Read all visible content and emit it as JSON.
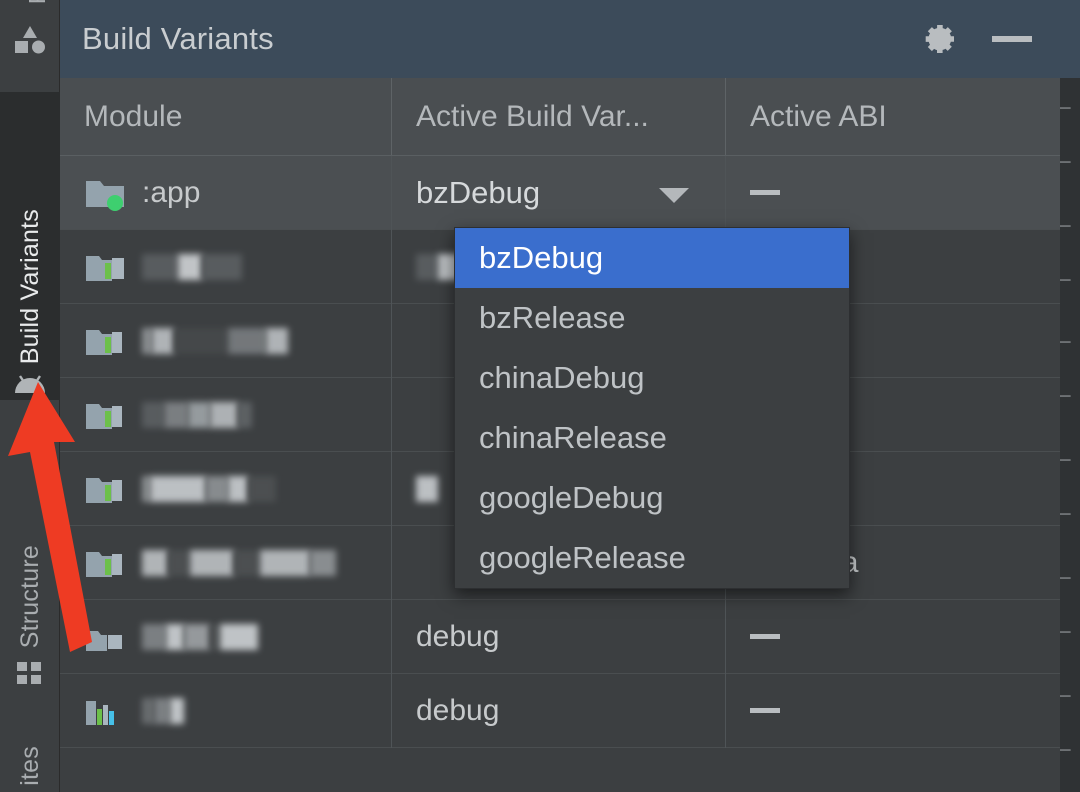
{
  "window": {
    "panel_title": "Build Variants",
    "settings_icon": "gear-icon",
    "minimize_icon": "minimize-icon"
  },
  "sidebar": {
    "clipped_top_label": "F",
    "top_icon": "resource-manager-shapes-icon",
    "items": [
      {
        "label": "Build Variants",
        "icon": "android-robot-icon",
        "active": true
      },
      {
        "label": "Structure",
        "icon": "structure-grid-icon",
        "active": false
      },
      {
        "label": "ites",
        "icon": "favorites-icon",
        "active": false
      }
    ]
  },
  "table": {
    "columns": [
      "Module",
      "Active Build Var...",
      "Active ABI"
    ],
    "rows": [
      {
        "module": ":app",
        "module_icon": "folder-green-dot-icon",
        "variant": "bzDebug",
        "variant_is_combo": true,
        "abi": "—",
        "selected": true
      },
      {
        "module": "",
        "module_icon": "module-green-bar-icon",
        "variant": "",
        "variant_is_combo": false,
        "abi": "",
        "selected": false
      },
      {
        "module": "",
        "module_icon": "module-green-bar-icon",
        "variant": "",
        "variant_is_combo": false,
        "abi": "",
        "selected": false
      },
      {
        "module": "",
        "module_icon": "module-green-bar-icon",
        "variant": "",
        "variant_is_combo": false,
        "abi": "",
        "selected": false
      },
      {
        "module": "",
        "module_icon": "module-green-bar-icon",
        "variant": "",
        "variant_is_combo": false,
        "abi": "",
        "selected": false
      },
      {
        "module": "",
        "module_icon": "module-green-bar-icon",
        "variant": "",
        "variant_is_combo": false,
        "abi": "n64-v8a",
        "selected": false
      },
      {
        "module": "",
        "module_icon": "module-plain-icon",
        "variant": "debug",
        "variant_is_combo": false,
        "abi": "—",
        "selected": false
      },
      {
        "module": "",
        "module_icon": "module-chart-icon",
        "variant": "debug",
        "variant_is_combo": false,
        "abi": "—",
        "selected": false
      }
    ]
  },
  "dropdown": {
    "open": true,
    "selected": "bzDebug",
    "options": [
      "bzDebug",
      "bzRelease",
      "chinaDebug",
      "chinaRelease",
      "googleDebug",
      "googleRelease"
    ]
  },
  "annotation": {
    "type": "arrow",
    "color": "#ee3b23",
    "points_to": "android-robot-icon"
  },
  "colors": {
    "panel_header_bg": "#3c4b5a",
    "table_header_bg": "#4a4e51",
    "body_bg": "#3c3f41",
    "selection_blue": "#3a6ecd",
    "accent_green": "#3ecf6f",
    "text_primary": "#c7cacc",
    "arrow_red": "#ee3b23"
  }
}
